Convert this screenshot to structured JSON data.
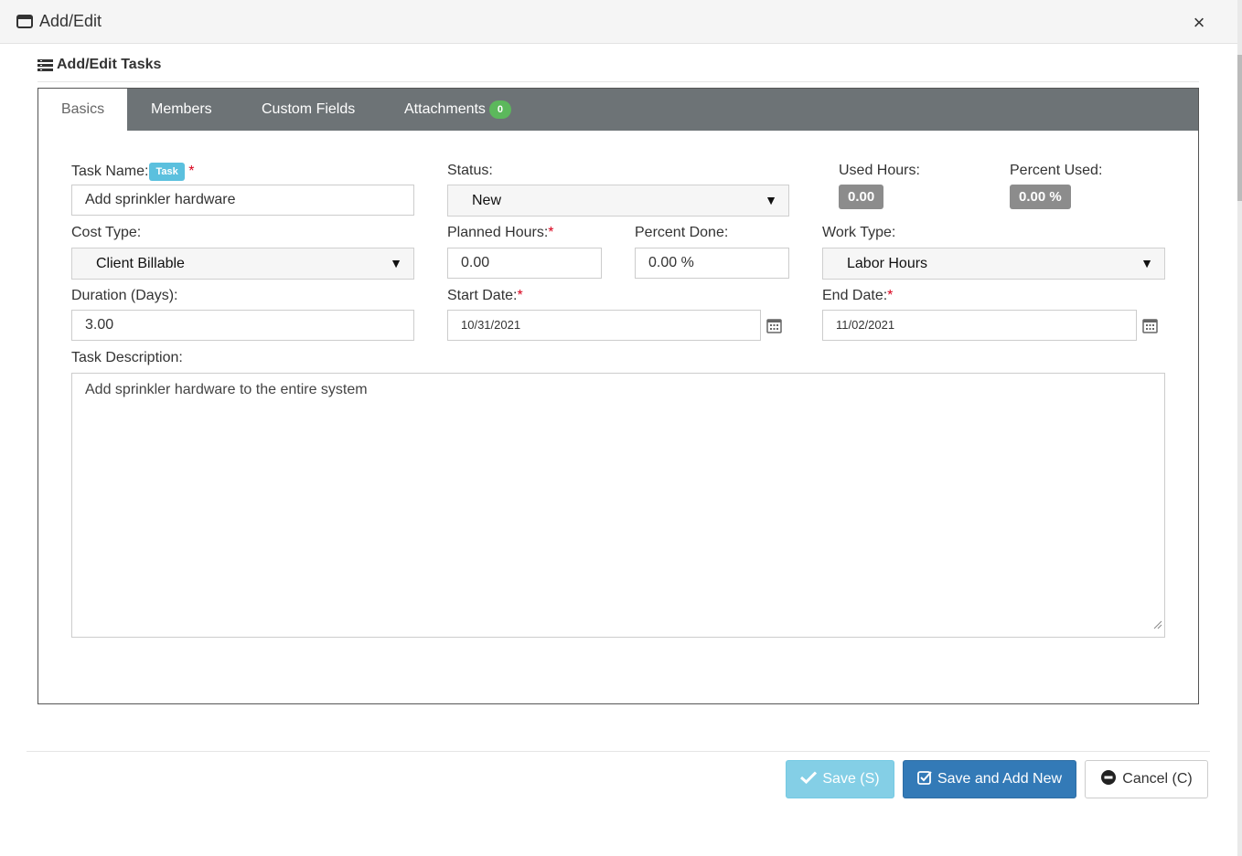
{
  "window": {
    "title": "Add/Edit",
    "close_label": "×"
  },
  "section": {
    "title": "Add/Edit Tasks"
  },
  "tabs": [
    {
      "label": "Basics",
      "active": true
    },
    {
      "label": "Members"
    },
    {
      "label": "Custom Fields"
    },
    {
      "label": "Attachments",
      "badge": "0"
    }
  ],
  "form": {
    "task_name": {
      "label": "Task Name:",
      "tag": "Task",
      "required": "*",
      "value": "Add sprinkler hardware"
    },
    "status": {
      "label": "Status:",
      "value": "New"
    },
    "used_hours": {
      "label": "Used Hours:",
      "value": "0.00"
    },
    "percent_used": {
      "label": "Percent Used:",
      "value": "0.00 %"
    },
    "cost_type": {
      "label": "Cost Type:",
      "value": "Client Billable"
    },
    "planned_hours": {
      "label": "Planned Hours:",
      "required": "*",
      "value": "0.00"
    },
    "percent_done": {
      "label": "Percent Done:",
      "value": "0.00 %"
    },
    "work_type": {
      "label": "Work Type:",
      "value": "Labor Hours"
    },
    "duration": {
      "label": "Duration (Days):",
      "value": "3.00"
    },
    "start_date": {
      "label": "Start Date:",
      "required": "*",
      "value": "10/31/2021"
    },
    "end_date": {
      "label": "End Date:",
      "required": "*",
      "value": "11/02/2021"
    },
    "description": {
      "label": "Task Description:",
      "value": "Add sprinkler hardware to the entire system"
    }
  },
  "buttons": {
    "save": "Save (S)",
    "save_add_new": "Save and Add New",
    "cancel": "Cancel (C)"
  },
  "icons": {
    "window": "window-icon",
    "section": "list-icon",
    "calendar": "calendar-icon",
    "save": "check-icon",
    "save_add_new": "check-square-icon",
    "cancel": "minus-circle-icon"
  },
  "colors": {
    "tabbar": "#6d7376",
    "badge": "#5cb85c",
    "tag": "#5bc0de",
    "required": "#d9001b",
    "save": "#5bc0de",
    "save_add_new": "#337ab7"
  }
}
